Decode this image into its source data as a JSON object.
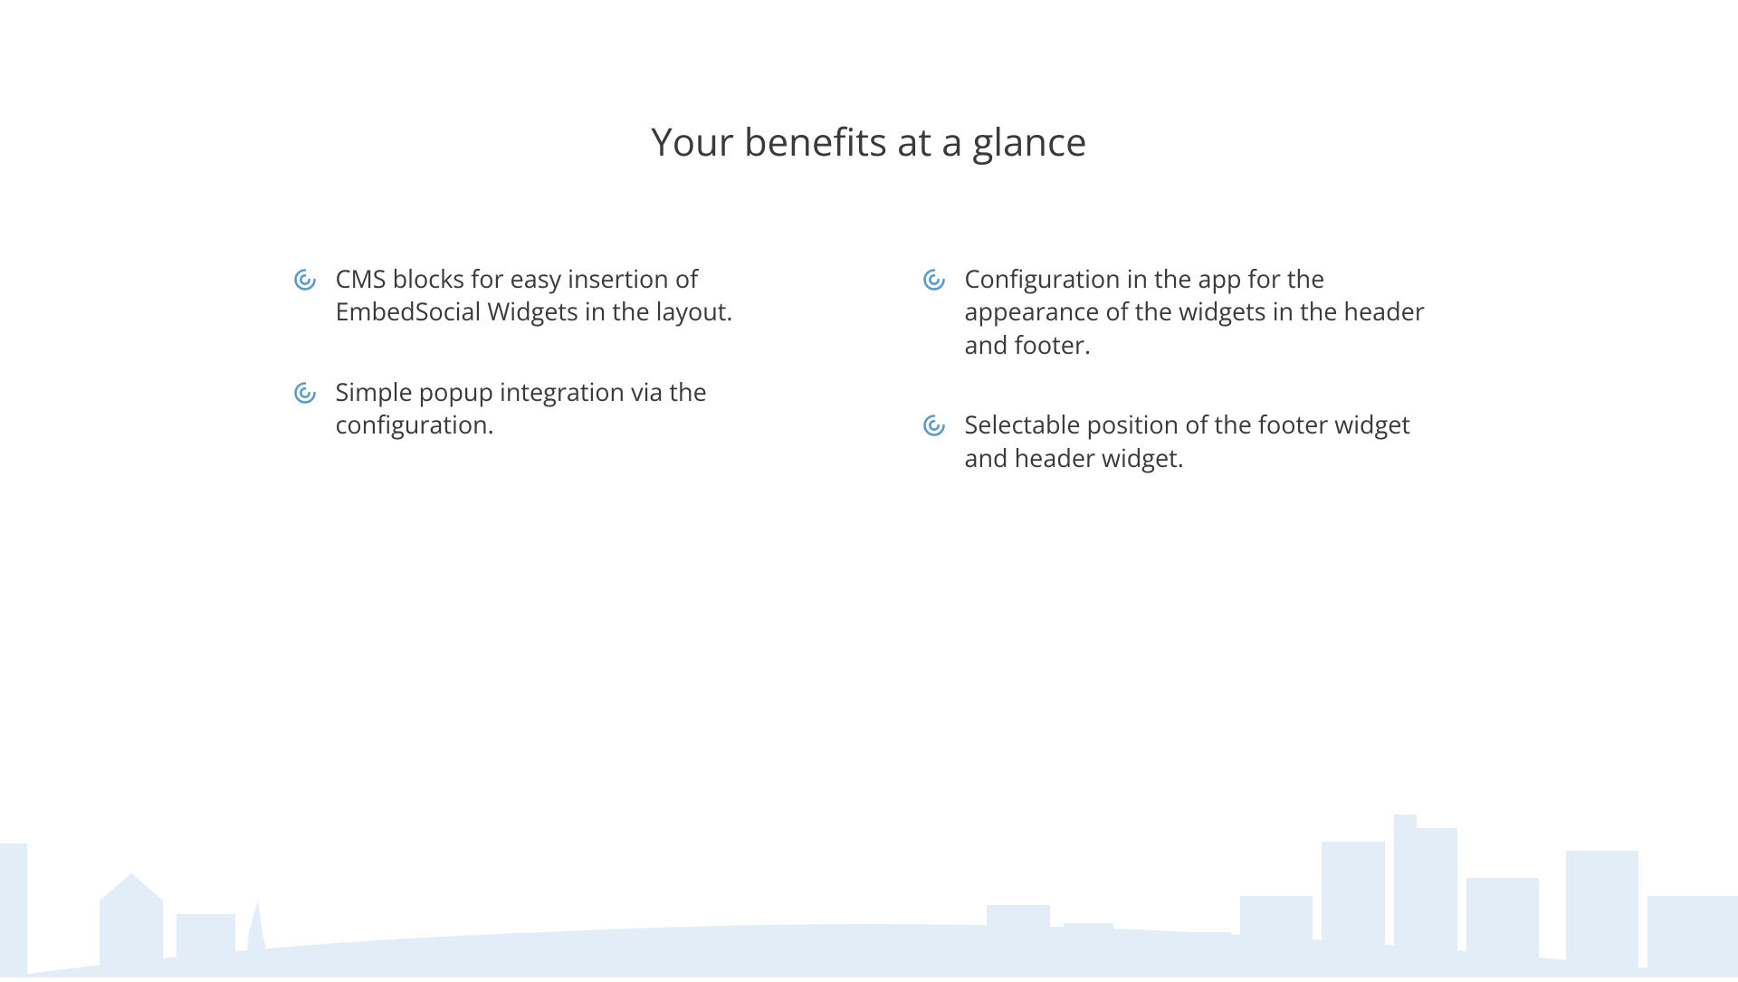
{
  "heading": "Your benefits at a glance",
  "benefits": {
    "left": [
      {
        "text": "CMS blocks for easy insertion of EmbedSocial Widgets in the layout."
      },
      {
        "text": "Simple popup integration via the configuration."
      }
    ],
    "right": [
      {
        "text": "Configuration in the app for the appearance of the widgets in the header and footer."
      },
      {
        "text": "Selectable position of the footer widget and header widget."
      }
    ]
  },
  "colors": {
    "icon": "#5a9bc7",
    "text": "#3a3a3a",
    "skyline": "#e3edf7"
  }
}
